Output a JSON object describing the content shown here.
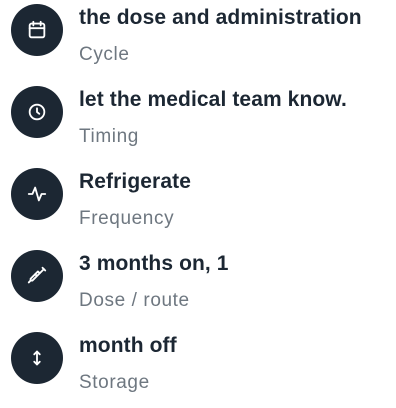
{
  "colors": {
    "badge_background": "#1c2733",
    "icon_stroke": "#ffffff",
    "title_text": "#1c2733",
    "subtitle_text": "#6e7780"
  },
  "details": [
    {
      "icon": "calendar-icon",
      "title": "the dose and administration",
      "subtitle": "Cycle"
    },
    {
      "icon": "clock-icon",
      "title": "let the medical team know.",
      "subtitle": "Timing"
    },
    {
      "icon": "pulse-icon",
      "title": "Refrigerate",
      "subtitle": "Frequency"
    },
    {
      "icon": "syringe-icon",
      "title": "3 months on, 1",
      "subtitle": "Dose / route"
    },
    {
      "icon": "vertical-arrows-icon",
      "title": "month off",
      "subtitle": "Storage"
    }
  ]
}
